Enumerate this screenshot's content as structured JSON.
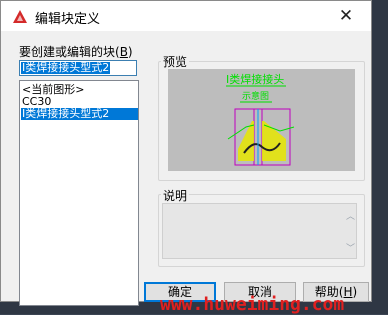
{
  "dialog": {
    "title": "编辑块定义",
    "close_glyph": "✕"
  },
  "left": {
    "label_main": "要创建或编辑的块(",
    "label_key": "B",
    "label_end": ")",
    "name_value": "I类焊接接头型式2",
    "list_items": [
      "<当前图形>",
      "CC30",
      "I类焊接接头型式2"
    ],
    "selected_index": 2
  },
  "preview": {
    "label": "预览",
    "drawing_title": "I类焊接接头",
    "drawing_subtitle": "示意图"
  },
  "description": {
    "label": "说明",
    "value": ""
  },
  "buttons": {
    "ok": "确定",
    "cancel": "取消",
    "help_main": "帮助(",
    "help_key": "H",
    "help_end": ")"
  },
  "watermark": "www.huweiming.com",
  "colors": {
    "selection": "#0078d7",
    "drawing_text": "#00e000",
    "drawing_frame": "#c000c0",
    "cad_yellow": "#e8e800",
    "watermark": "#e02020"
  },
  "icons": {
    "app": "autocad-a-icon",
    "scroll_up": "chevron-up-icon",
    "scroll_down": "chevron-down-icon"
  }
}
